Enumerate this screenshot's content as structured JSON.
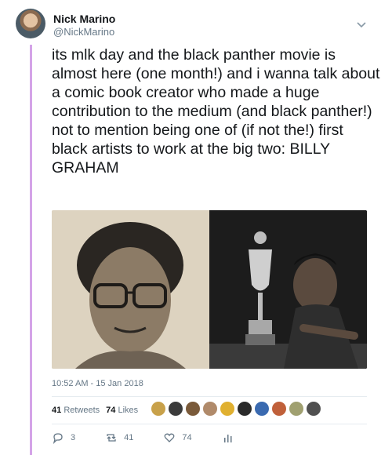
{
  "author": {
    "name": "Nick Marino",
    "handle": "@NickMarino"
  },
  "tweet": {
    "text": "its mlk day and the black panther movie is almost here (one month!) and i wanna talk about a comic book creator who made a huge contribution to the medium (and black panther!) not to mention being one of (if not the!) first black artists to work at the big two: BILLY GRAHAM",
    "timestamp": "10:52 AM - 15 Jan 2018"
  },
  "stats": {
    "retweets_count": "41",
    "retweets_label": "Retweets",
    "likes_count": "74",
    "likes_label": "Likes"
  },
  "likers": [
    {
      "icon": "liker-avatar-1",
      "color": "#c8a14a"
    },
    {
      "icon": "liker-avatar-2",
      "color": "#3b3b3b"
    },
    {
      "icon": "liker-avatar-3",
      "color": "#7a5a3a"
    },
    {
      "icon": "liker-avatar-4",
      "color": "#b08a6a"
    },
    {
      "icon": "liker-avatar-5",
      "color": "#e0b030"
    },
    {
      "icon": "liker-avatar-6",
      "color": "#2a2a2a"
    },
    {
      "icon": "liker-avatar-7",
      "color": "#3a6ab0"
    },
    {
      "icon": "liker-avatar-8",
      "color": "#c0603a"
    },
    {
      "icon": "liker-avatar-9",
      "color": "#a0a070"
    },
    {
      "icon": "liker-avatar-10",
      "color": "#505050"
    }
  ],
  "actions": {
    "reply_count": "3",
    "retweet_count": "41",
    "like_count": "74"
  },
  "colors": {
    "thread_line": "#d4a4e8",
    "secondary_text": "#657786",
    "primary_text": "#14171a"
  }
}
